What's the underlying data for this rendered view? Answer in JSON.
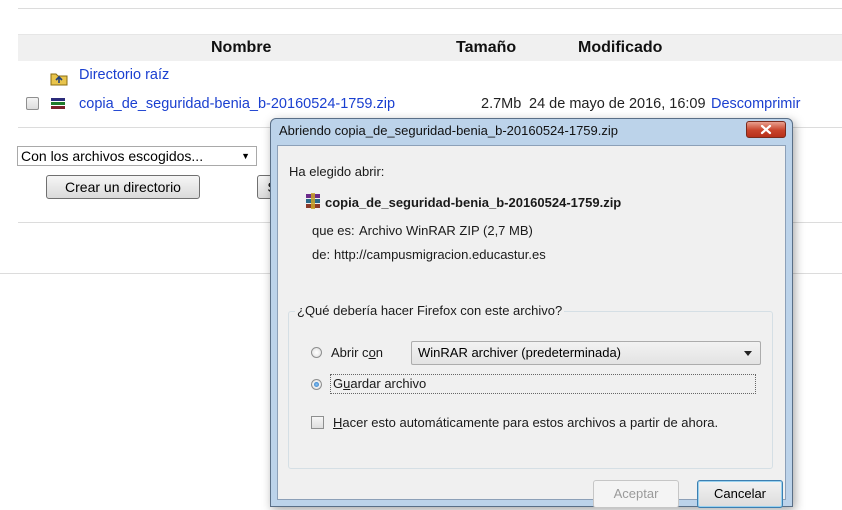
{
  "background": {
    "columns": {
      "name": "Nombre",
      "size": "Tamaño",
      "modified": "Modificado"
    },
    "root_link": "Directorio raíz",
    "file": {
      "name": "copia_de_seguridad-benia_b-20160524-1759.zip",
      "size": "2.7Mb",
      "modified": "24 de mayo de 2016, 16:09",
      "action": "Descomprimir"
    },
    "bulk_select": "Con los archivos escogidos...",
    "create_dir_button": "Crear un directorio",
    "second_button": "S"
  },
  "dialog": {
    "title": "Abriendo copia_de_seguridad-benia_b-20160524-1759.zip",
    "chose_open": "Ha elegido abrir:",
    "filename": "copia_de_seguridad-benia_b-20160524-1759.zip",
    "type_label": "que es:",
    "type_value": "Archivo WinRAR ZIP (2,7 MB)",
    "from_label": "de:",
    "from_value": "http://campusmigracion.educastur.es",
    "question": "¿Qué debería hacer Firefox con este archivo?",
    "open_with_pre": "Abrir c",
    "open_with_acc": "o",
    "open_with_post": "n",
    "open_with_app": "WinRAR archiver (predeterminada)",
    "save_pre": "G",
    "save_acc": "u",
    "save_post": "ardar archivo",
    "auto_pre": "",
    "auto_acc": "H",
    "auto_post": "acer esto automáticamente para estos archivos a partir de ahora.",
    "accept_button": "Aceptar",
    "cancel_button": "Cancelar",
    "selected_option": "save"
  },
  "colors": {
    "link": "#1a3fd0",
    "dialog_frame": "#bcd3ea",
    "close": "#c8432b"
  },
  "icons": [
    "folder-up-icon",
    "winrar-icon",
    "close-icon",
    "dropdown-arrow-icon"
  ]
}
